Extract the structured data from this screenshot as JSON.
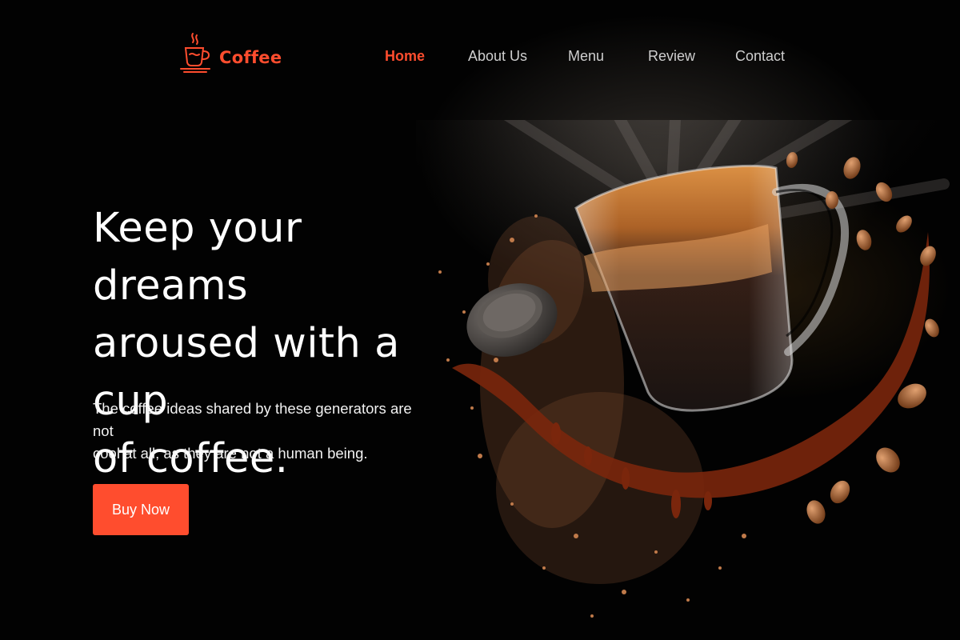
{
  "brand": {
    "name": "Coffee",
    "icon": "coffee-cup-icon",
    "accent_color": "#ff4d2e"
  },
  "nav": {
    "items": [
      {
        "label": "Home",
        "active": true
      },
      {
        "label": "About Us",
        "active": false
      },
      {
        "label": "Menu",
        "active": false
      },
      {
        "label": "Review",
        "active": false
      },
      {
        "label": "Contact",
        "active": false
      }
    ]
  },
  "hero": {
    "headline_lines": [
      "Keep your dreams",
      "aroused with a cup",
      "of coffee."
    ],
    "subtext_lines": [
      "The coffee ideas shared by these generators are not",
      "cool at all, as they are not a human being."
    ],
    "cta_label": "Buy Now",
    "image": "coffee-glass-splash-image"
  },
  "colors": {
    "background": "#000000",
    "text": "#ffffff",
    "nav_text": "#cfcfcf",
    "accent": "#ff4d2e"
  }
}
